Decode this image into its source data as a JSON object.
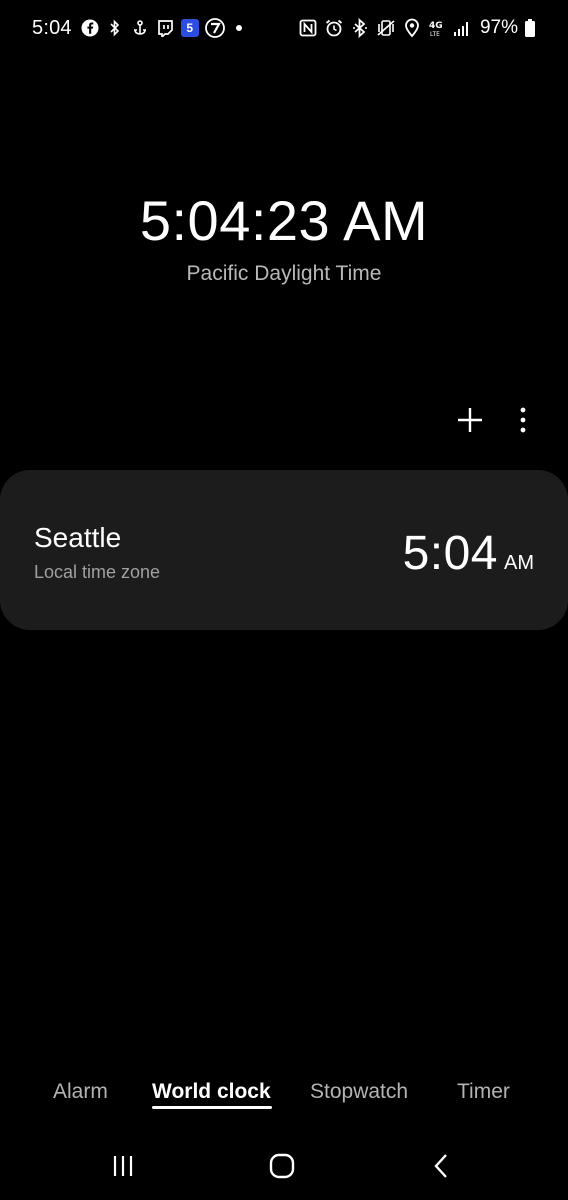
{
  "status_bar": {
    "time": "5:04",
    "battery_percent": "97%",
    "left_icons": [
      "facebook-icon",
      "bluetooth-small-icon",
      "anchor-icon",
      "twitch-icon",
      "blue-app-icon",
      "channel7-icon",
      "notification-dot-icon"
    ],
    "right_icons": [
      "nfc-icon",
      "alarm-icon",
      "bluetooth-icon",
      "vibrate-icon",
      "location-icon",
      "4g-lte-icon",
      "signal-icon",
      "battery-icon"
    ],
    "network_label": "4G"
  },
  "clock": {
    "current_time": "5:04:23 AM",
    "timezone_name": "Pacific Daylight Time"
  },
  "actions": {
    "add_icon": "plus-icon",
    "more_icon": "more-vert-icon"
  },
  "cities": [
    {
      "name": "Seattle",
      "subtitle": "Local time zone",
      "time": "5:04",
      "ampm": "AM"
    }
  ],
  "tabs": [
    {
      "label": "Alarm",
      "active": false
    },
    {
      "label": "World clock",
      "active": true
    },
    {
      "label": "Stopwatch",
      "active": false
    },
    {
      "label": "Timer",
      "active": false
    }
  ],
  "nav": {
    "recents_icon": "recents-icon",
    "home_icon": "home-icon",
    "back_icon": "back-icon"
  },
  "colors": {
    "background": "#000000",
    "card": "#1c1c1c",
    "text_primary": "#ffffff",
    "text_secondary": "#a0a0a0"
  }
}
